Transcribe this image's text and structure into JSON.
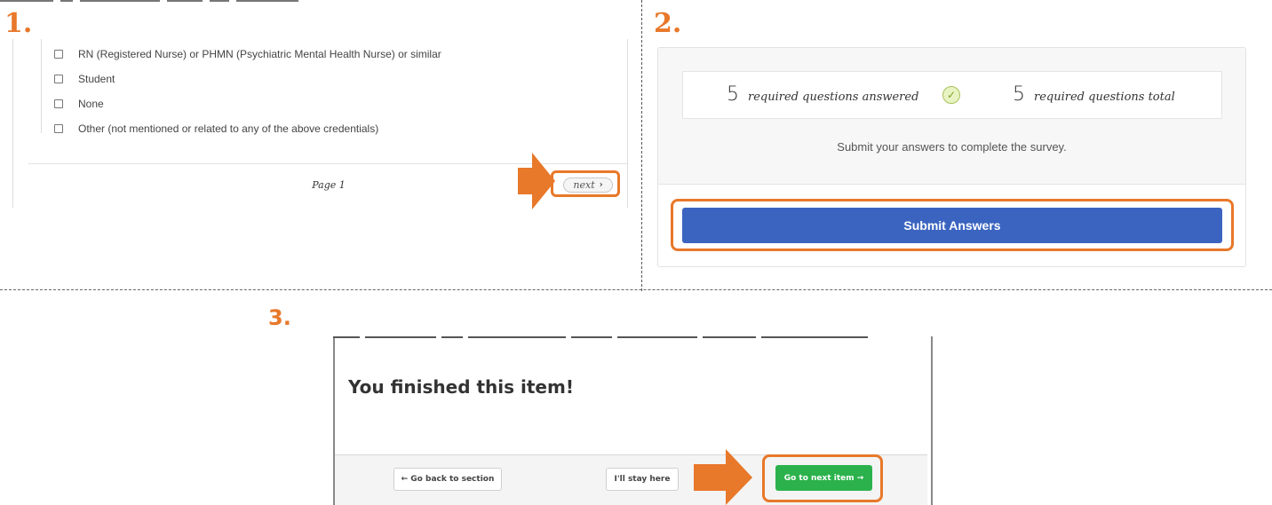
{
  "steps": {
    "one": "1.",
    "two": "2.",
    "three": "3."
  },
  "accent_color": "#e8782a",
  "panel1": {
    "options": [
      {
        "label": "RN (Registered Nurse) or PHMN (Psychiatric Mental Health Nurse) or similar",
        "checked": false
      },
      {
        "label": "Student",
        "checked": false
      },
      {
        "label": "None",
        "checked": false
      },
      {
        "label": "Other (not mentioned or related to any of the above credentials)",
        "checked": false
      }
    ],
    "page_label": "Page 1",
    "next_label": "next",
    "next_icon": "chevron-right-icon"
  },
  "panel2": {
    "answered_count": "5",
    "answered_text": "required questions answered",
    "total_count": "5",
    "total_text": "required questions total",
    "check_icon": "check-circle-icon",
    "message": "Submit your answers to complete the survey.",
    "submit_label": "Submit Answers",
    "submit_color": "#3a64c0"
  },
  "panel3": {
    "title": "You finished this item!",
    "back_label": "← Go back to section",
    "stay_label": "I'll stay here",
    "next_label": "Go to next item →",
    "next_color": "#2bb24c"
  }
}
